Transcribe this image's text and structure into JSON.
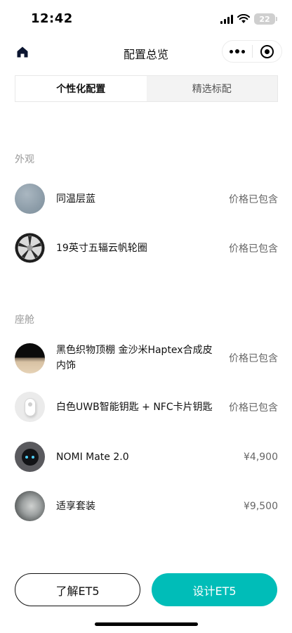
{
  "status_bar": {
    "time": "12:42",
    "battery": "22"
  },
  "nav": {
    "title": "配置总览"
  },
  "tabs": [
    {
      "label": "个性化配置",
      "active": true
    },
    {
      "label": "精选标配",
      "active": false
    }
  ],
  "sections": {
    "exterior": {
      "title": "外观",
      "items": [
        {
          "name": "同温层蓝",
          "price": "价格已包含"
        },
        {
          "name": "19英寸五辐云帆轮圈",
          "price": "价格已包含"
        }
      ]
    },
    "cabin": {
      "title": "座舱",
      "items": [
        {
          "name": "黑色织物顶棚 金沙米Haptex合成皮内饰",
          "price": "价格已包含"
        },
        {
          "name": "白色UWB智能钥匙 + NFC卡片钥匙",
          "price": "价格已包含"
        },
        {
          "name": "NOMI Mate 2.0",
          "price": "¥4,900"
        },
        {
          "name": "适享套装",
          "price": "¥9,500"
        }
      ]
    }
  },
  "buttons": {
    "learn": "了解ET5",
    "design": "设计ET5"
  },
  "colors": {
    "accent": "#00bdb8",
    "text": "#111111",
    "muted": "#9a9a9a"
  }
}
